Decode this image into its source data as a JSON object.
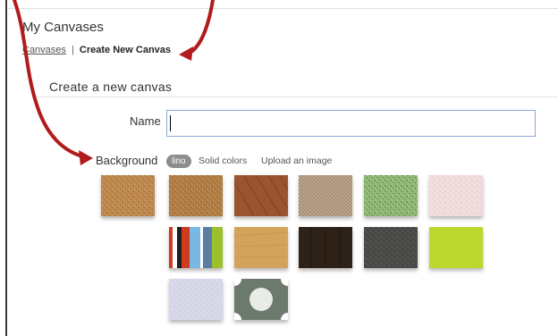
{
  "page": {
    "title": "My Canvases"
  },
  "breadcrumb": {
    "link_label": "Canvases",
    "separator": "|",
    "current_label": "Create New Canvas"
  },
  "form": {
    "heading": "Create a new canvas",
    "name_label": "Name",
    "name_value": "",
    "background_label": "Background"
  },
  "background_tabs": [
    {
      "label": "lino",
      "active": true
    },
    {
      "label": "Solid colors",
      "active": false
    },
    {
      "label": "Upload an image",
      "active": false
    }
  ],
  "swatches": [
    {
      "name": "cork",
      "color": "#c08a4e"
    },
    {
      "name": "cork-dark",
      "color": "#b37f45"
    },
    {
      "name": "wood-brown",
      "color": "#9a5530"
    },
    {
      "name": "burlap",
      "color": "#bea58c"
    },
    {
      "name": "green-felt",
      "color": "#8fb875"
    },
    {
      "name": "pink-paper",
      "color": "#f3dcdd"
    },
    {
      "name": "stripes",
      "colors": [
        "#d03a1e",
        "#ffffff",
        "#1e1e1e",
        "#79b7e4",
        "#ffffff",
        "#5a7ea3",
        "#9bbf2d"
      ]
    },
    {
      "name": "light-wood",
      "color": "#d3a35c"
    },
    {
      "name": "dark-wood",
      "color": "#2e2118"
    },
    {
      "name": "dark-gray",
      "color": "#4a4a48"
    },
    {
      "name": "lime",
      "color": "#bcd82e"
    },
    {
      "name": "lavender",
      "color": "#d8d8ea"
    },
    {
      "name": "pattern-gray",
      "color": "#6b7a6c"
    }
  ],
  "annotation": {
    "arrow_color": "#b11b1b"
  }
}
